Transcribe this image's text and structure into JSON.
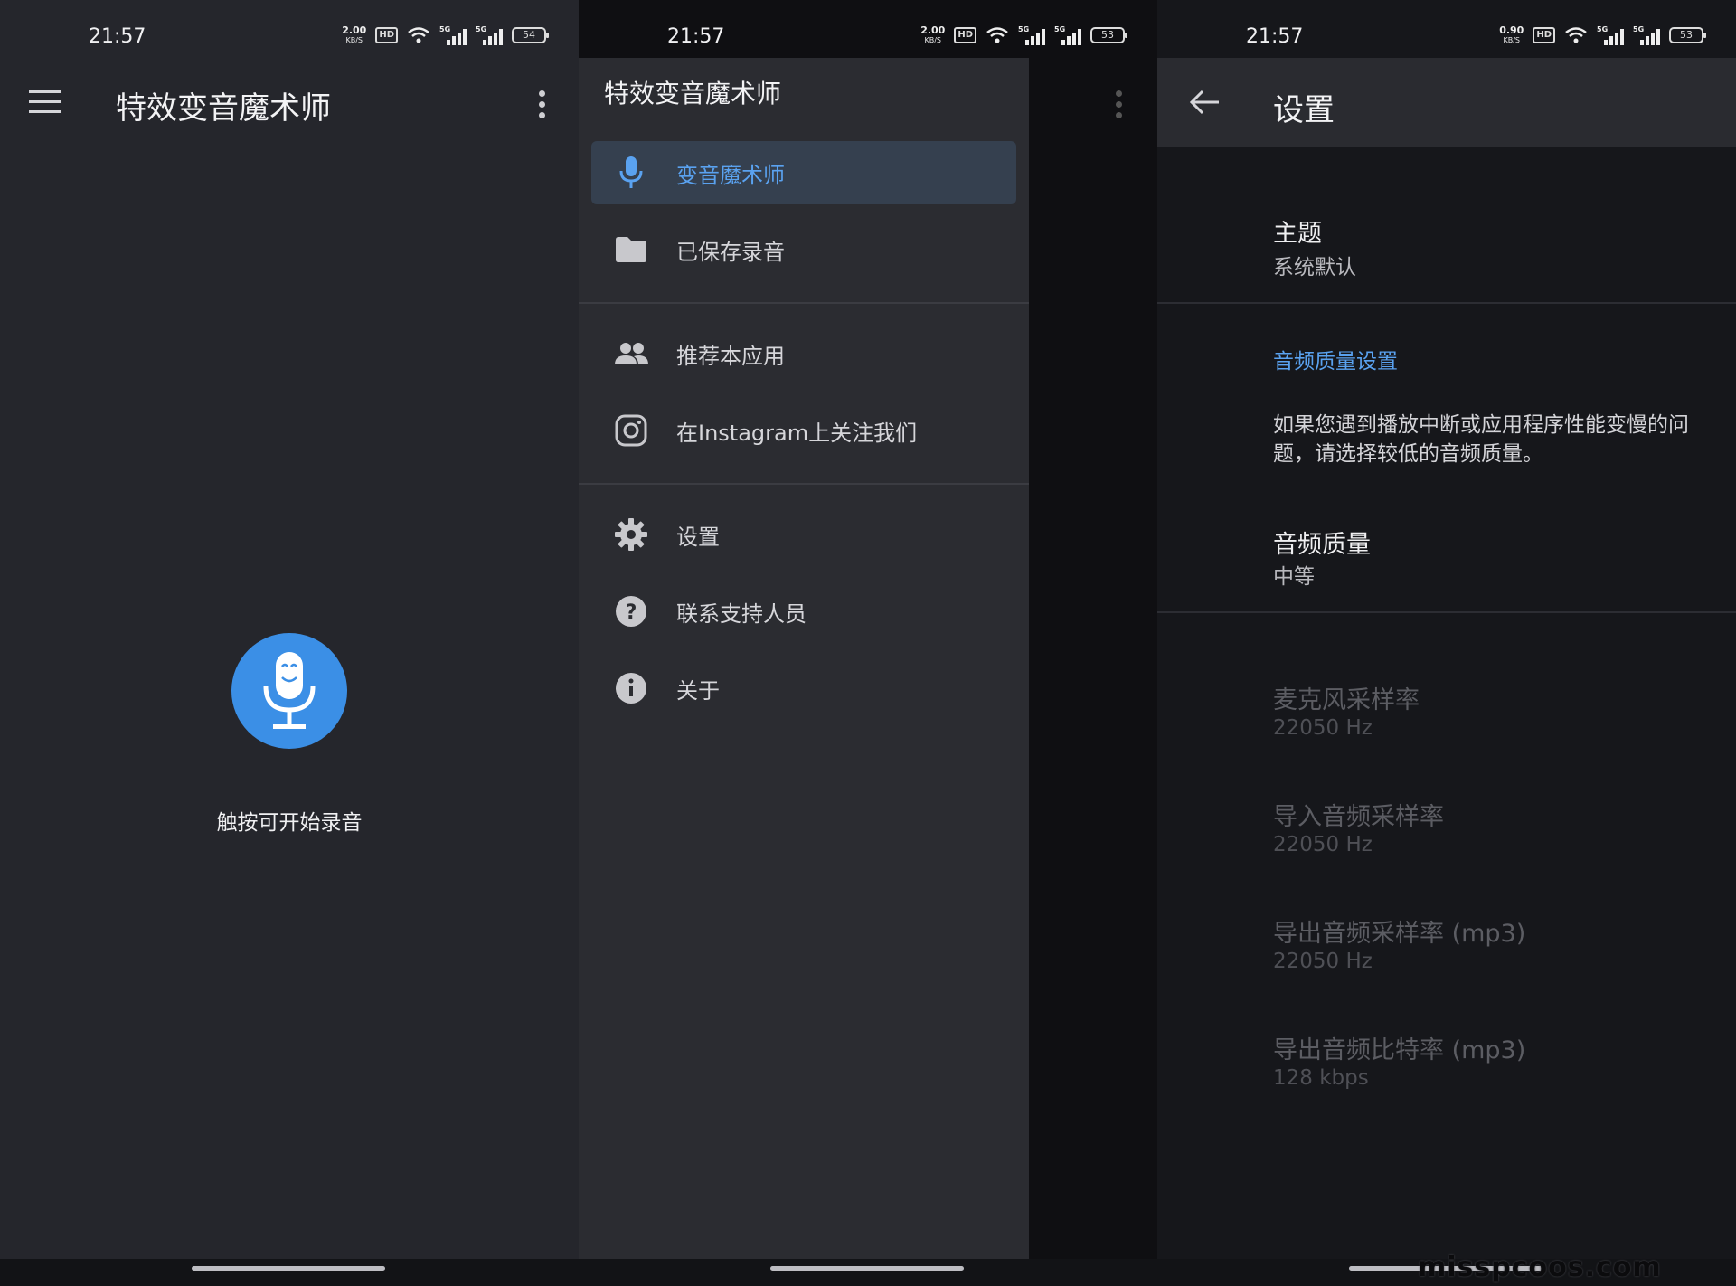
{
  "status_bar": {
    "time": "21:57",
    "speed_unit": "KB/S",
    "hd_label": "HD",
    "signal_label": "5G",
    "panels": [
      {
        "speed": "2.00",
        "battery": "54"
      },
      {
        "speed": "2.00",
        "battery": "53"
      },
      {
        "speed": "0.90",
        "battery": "53"
      }
    ]
  },
  "main_screen": {
    "title": "特效变音魔术师",
    "mic_icon": "smiling-microphone-icon",
    "hint": "触按可开始录音"
  },
  "drawer": {
    "header": "特效变音魔术师",
    "items": [
      {
        "label": "变音魔术师",
        "icon": "microphone-icon",
        "active": true
      },
      {
        "label": "已保存录音",
        "icon": "folder-icon",
        "active": false
      },
      {
        "label": "推荐本应用",
        "icon": "people-icon",
        "active": false
      },
      {
        "label": "在Instagram上关注我们",
        "icon": "instagram-icon",
        "active": false
      },
      {
        "label": "设置",
        "icon": "gear-icon",
        "active": false
      },
      {
        "label": "联系支持人员",
        "icon": "help-icon",
        "active": false
      },
      {
        "label": "关于",
        "icon": "info-icon",
        "active": false
      }
    ]
  },
  "settings": {
    "title": "设置",
    "theme": {
      "title": "主题",
      "summary": "系统默认"
    },
    "audio_section": "音频质量设置",
    "audio_description": "如果您遇到播放中断或应用程序性能变慢的问题，请选择较低的音频质量。",
    "audio_quality": {
      "title": "音频质量",
      "summary": "中等"
    },
    "disabled_prefs": [
      {
        "title": "麦克风采样率",
        "summary": "22050 Hz"
      },
      {
        "title": "导入音频采样率",
        "summary": "22050 Hz"
      },
      {
        "title": "导出音频采样率 (mp3)",
        "summary": "22050 Hz"
      },
      {
        "title": "导出音频比特率 (mp3)",
        "summary": "128 kbps"
      }
    ]
  },
  "watermark": "misspcoos.com",
  "colors": {
    "accent": "#3b8fe6",
    "accent_text": "#5aa2f0",
    "main_bg": "#25262c",
    "drawer_bg": "#2b2c31",
    "settings_bg": "#16171b"
  }
}
